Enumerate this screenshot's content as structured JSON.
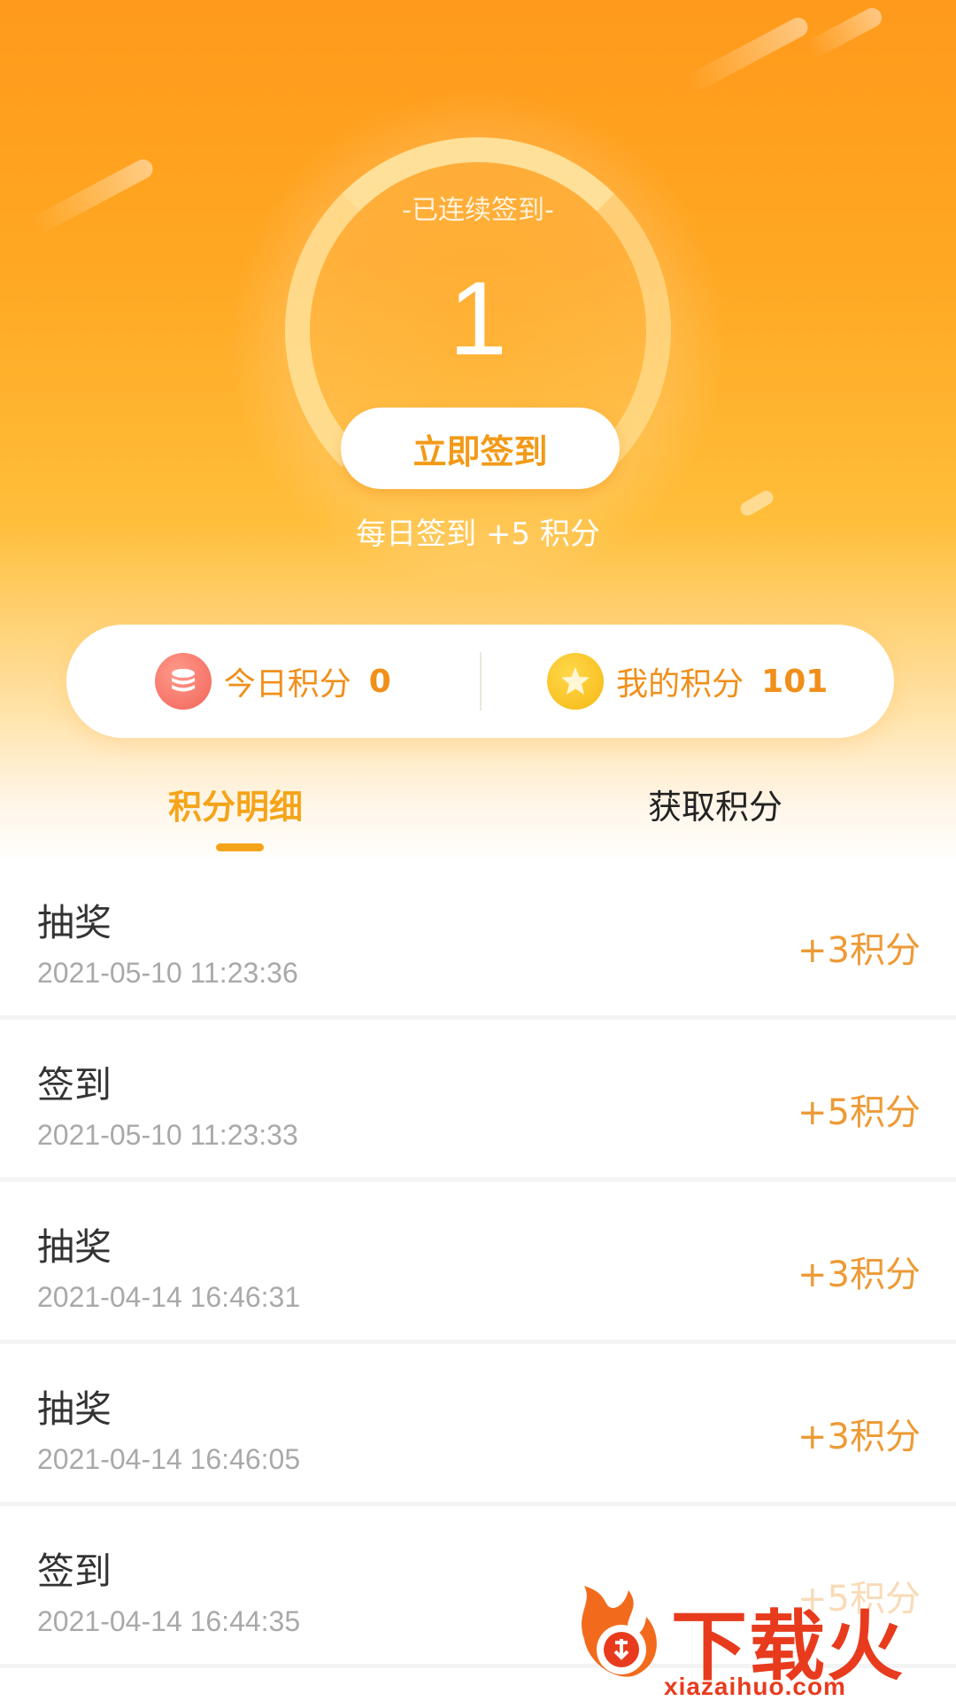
{
  "header": {
    "streak_label": "-已连续签到-",
    "streak_count": "1",
    "sign_button_label": "立即签到",
    "daily_bonus_text": "每日签到 +5 积分"
  },
  "summary": {
    "today_label": "今日积分",
    "today_value": "0",
    "mine_label": "我的积分",
    "mine_value": "101",
    "today_icon": "coin-stack-icon",
    "mine_icon": "star-coin-icon"
  },
  "tabs": [
    {
      "label": "积分明细",
      "active": true
    },
    {
      "label": "获取积分",
      "active": false
    }
  ],
  "records": [
    {
      "title": "抽奖",
      "time": "2021-05-10 11:23:36",
      "points": "+3积分"
    },
    {
      "title": "签到",
      "time": "2021-05-10 11:23:33",
      "points": "+5积分"
    },
    {
      "title": "抽奖",
      "time": "2021-04-14 16:46:31",
      "points": "+3积分"
    },
    {
      "title": "抽奖",
      "time": "2021-04-14 16:46:05",
      "points": "+3积分"
    },
    {
      "title": "签到",
      "time": "2021-04-14 16:44:35",
      "points": "+5积分"
    }
  ],
  "watermark": {
    "brand": "下载火",
    "url": "xiazaihuo.com",
    "icon": "flame-logo-icon"
  },
  "colors": {
    "accent": "#f5a419",
    "points": "#ee9a35",
    "watermark": "#e83b1e"
  }
}
